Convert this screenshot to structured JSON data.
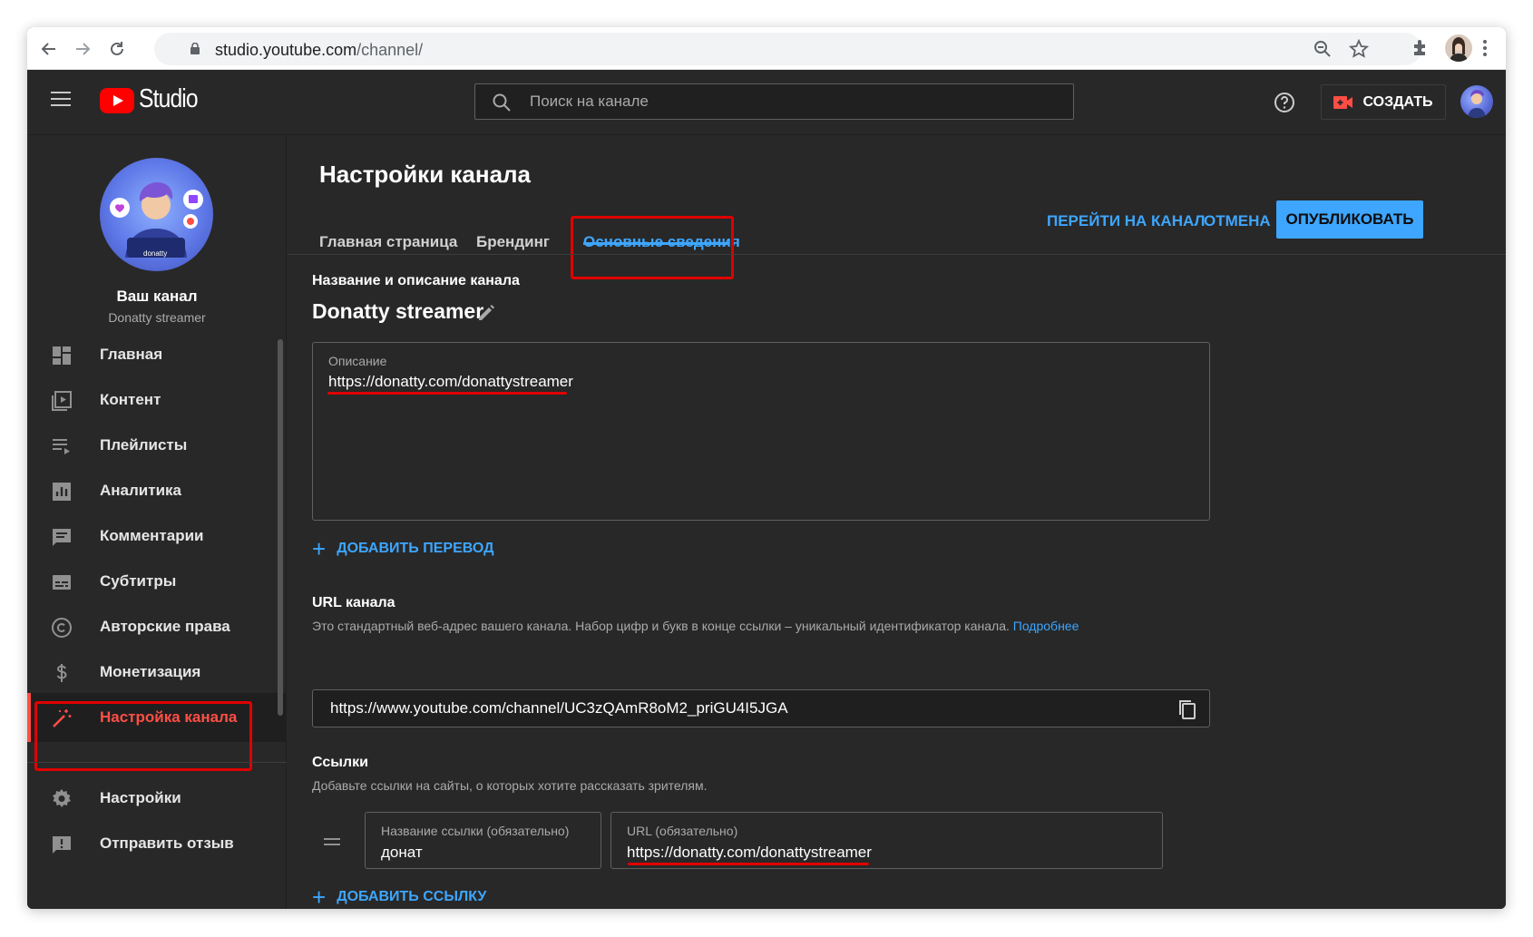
{
  "browser": {
    "url_host": "studio.youtube.com",
    "url_path": "/channel/"
  },
  "header": {
    "logo_text": "Studio",
    "search_placeholder": "Поиск на канале",
    "create_label": "СОЗДАТЬ"
  },
  "sidebar": {
    "channel_title": "Ваш канал",
    "channel_name": "Donatty streamer",
    "items": [
      {
        "label": "Главная",
        "icon": "dashboard-icon"
      },
      {
        "label": "Контент",
        "icon": "content-icon"
      },
      {
        "label": "Плейлисты",
        "icon": "playlists-icon"
      },
      {
        "label": "Аналитика",
        "icon": "analytics-icon"
      },
      {
        "label": "Комментарии",
        "icon": "comments-icon"
      },
      {
        "label": "Субтитры",
        "icon": "subtitles-icon"
      },
      {
        "label": "Авторские права",
        "icon": "copyright-icon"
      },
      {
        "label": "Монетизация",
        "icon": "monetization-icon"
      },
      {
        "label": "Настройка канала",
        "icon": "magic-wand-icon",
        "active": true
      }
    ],
    "bottom_items": [
      {
        "label": "Настройки",
        "icon": "gear-icon"
      },
      {
        "label": "Отправить отзыв",
        "icon": "feedback-icon"
      }
    ]
  },
  "main": {
    "title": "Настройки канала",
    "tabs": [
      {
        "label": "Главная страница"
      },
      {
        "label": "Брендинг"
      },
      {
        "label": "Основные сведения",
        "active": true
      }
    ],
    "actions": {
      "goto_label": "ПЕРЕЙТИ НА КАНАЛ",
      "cancel_label": "ОТМЕНА",
      "publish_label": "ОПУБЛИКОВАТЬ"
    },
    "name_section": {
      "label": "Название и описание канала",
      "channel_name": "Donatty streamer",
      "description_label": "Описание",
      "description_value": "https://donatty.com/donattystreamer",
      "add_translation": "ДОБАВИТЬ ПЕРЕВОД"
    },
    "url_section": {
      "label": "URL канала",
      "help": "Это стандартный веб-адрес вашего канала. Набор цифр и букв в конце ссылки – уникальный идентификатор канала.",
      "help_link": "Подробнее",
      "value": "https://www.youtube.com/channel/UC3zQAmR8oM2_priGU4I5JGA"
    },
    "links_section": {
      "label": "Ссылки",
      "help": "Добавьте ссылки на сайты, о которых хотите рассказать зрителям.",
      "link_name_label": "Название ссылки (обязательно)",
      "link_name_value": "донат",
      "link_url_label": "URL (обязательно)",
      "link_url_value": "https://donatty.com/donattystreamer",
      "add_link": "ДОБАВИТЬ ССЫЛКУ"
    }
  },
  "colors": {
    "accent_blue": "#3ea6ff",
    "active_red": "#ff4e45",
    "highlight_red": "#e00000",
    "background": "#282828"
  }
}
